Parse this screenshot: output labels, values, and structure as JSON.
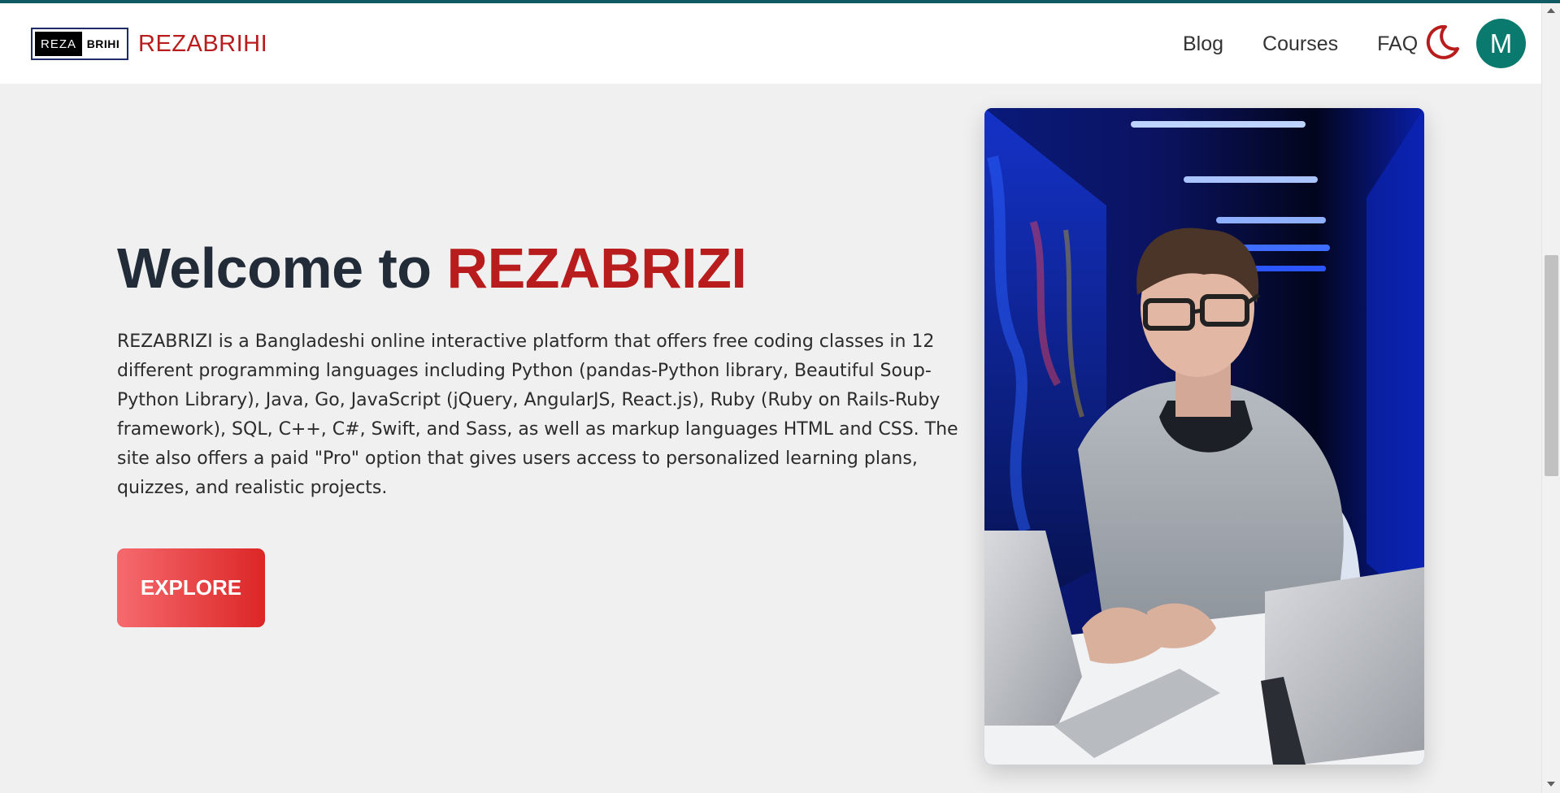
{
  "header": {
    "logo": {
      "left_text": "REZA",
      "right_text": "BRIHI"
    },
    "brand_name": "REZABRIHI",
    "nav": [
      {
        "label": "Blog"
      },
      {
        "label": "Courses"
      },
      {
        "label": "FAQ"
      }
    ],
    "theme_toggle_icon": "moon-icon",
    "avatar_initial": "M"
  },
  "hero": {
    "title_prefix": "Welcome to",
    "title_accent": "REZABRIZI",
    "description": "REZABRIZI is a Bangladeshi online interactive platform that offers free coding classes in 12 different programming languages including Python (pandas-Python library, Beautiful Soup-Python Library), Java, Go, JavaScript (jQuery, AngularJS, React.js), Ruby (Ruby on Rails-Ruby framework), SQL, C++, C#, Swift, and Sass, as well as markup languages HTML and CSS. The site also offers a paid \"Pro\" option that gives users access to personalized learning plans, quizzes, and realistic projects.",
    "cta_label": "EXPLORE"
  },
  "colors": {
    "accent_red": "#b91c1c",
    "avatar_teal": "#0b7a6e",
    "top_strip": "#0f5a63",
    "page_bg": "#f0f0f0"
  }
}
